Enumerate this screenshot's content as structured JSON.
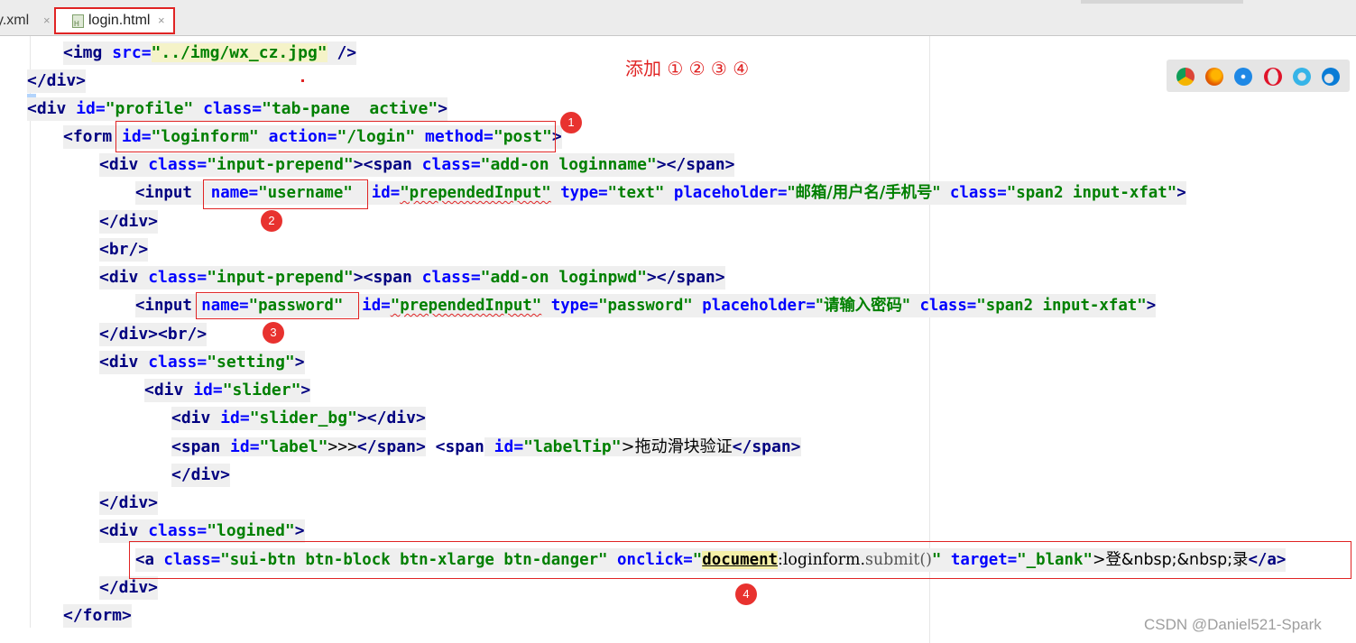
{
  "tabs": [
    {
      "label": "y.xml",
      "close": "×",
      "active": false
    },
    {
      "label": "login.html",
      "close": "×",
      "active": true
    }
  ],
  "annotation": {
    "title": "添加 ① ② ③ ④",
    "badges": [
      "1",
      "2",
      "3",
      "4"
    ]
  },
  "browsers": [
    "chrome-icon",
    "firefox-icon",
    "safari-icon",
    "opera-icon",
    "ie-icon",
    "edge-icon"
  ],
  "watermark": "CSDN @Daniel521-Spark",
  "code": {
    "l1": {
      "t1": "<img",
      "a1": " src=",
      "s1": "\"../img/wx_cz.jpg\"",
      "t2": " />"
    },
    "l2": {
      "t1": "</div>"
    },
    "l3": {
      "t1": "<div",
      "a1": " id=",
      "s1": "\"profile\"",
      "a2": " class=",
      "s2": "\"tab-pane  active\"",
      "t2": ">"
    },
    "l4": {
      "t1": "<form",
      "a1": " id=",
      "s1": "\"loginform\"",
      "a2": " action=",
      "s2": "\"/login\"",
      "a3": " method=",
      "s3": "\"post\"",
      "t2": ">"
    },
    "l5": {
      "t1": "<div",
      "a1": " class=",
      "s1": "\"input-prepend\"",
      "t2": "><span",
      "a2": " class=",
      "s2": "\"add-on loginname\"",
      "t3": "></span>"
    },
    "l6": {
      "t1": "<input",
      "a1": "  name=",
      "s1": "\"username\"",
      "a2": "  id=",
      "s2": "\"prependedInput\"",
      "a3": " type=",
      "s3": "\"text\"",
      "a4": " placeholder=",
      "s4": "\"邮箱/用户名/手机号\"",
      "a5": " class=",
      "s5": "\"span2 input-xfat\"",
      "t2": ">"
    },
    "l7": {
      "t1": "</div>"
    },
    "l8": {
      "t1": "<br/>"
    },
    "l9": {
      "t1": "<div",
      "a1": " class=",
      "s1": "\"input-prepend\"",
      "t2": "><span",
      "a2": " class=",
      "s2": "\"add-on loginpwd\"",
      "t3": "></span>"
    },
    "l10": {
      "t1": "<input",
      "a1": " name=",
      "s1": "\"password\"",
      "a2": "  id=",
      "s2": "\"prependedInput\"",
      "a3": " type=",
      "s3": "\"password\"",
      "a4": " placeholder=",
      "s4": "\"请输入密码\"",
      "a5": " class=",
      "s5": "\"span2 input-xfat\"",
      "t2": ">"
    },
    "l11": {
      "t1": "</div><br/>"
    },
    "l12": {
      "t1": "<div",
      "a1": " class=",
      "s1": "\"setting\"",
      "t2": ">"
    },
    "l13": {
      "t1": "<div",
      "a1": " id=",
      "s1": "\"slider\"",
      "t2": ">"
    },
    "l14": {
      "t1": "<div",
      "a1": " id=",
      "s1": "\"slider_bg\"",
      "t2": "></div>"
    },
    "l15": {
      "t1": "<span",
      "a1": " id=",
      "s1": "\"label\"",
      "p1": ">>>",
      "t2": "</span>",
      "t3": " <span",
      "a2": " id=",
      "s2": "\"labelTip\"",
      "p2": ">拖动滑块验证",
      "t4": "</span>"
    },
    "l16": {
      "t1": "</div>"
    },
    "l17": {
      "t1": "</div>"
    },
    "l18": {
      "t1": "<div",
      "a1": " class=",
      "s1": "\"logined\"",
      "t2": ">"
    },
    "l19": {
      "t1": "<a",
      "a1": " class=",
      "s1": "\"sui-btn btn-block btn-xlarge btn-danger\"",
      "a2": " onclick=",
      "s1b": "\"",
      "doc": "document",
      "p1": ":loginform.",
      "m1": "submit()",
      "s2": "\"",
      "a3": " target=",
      "s3": "\"_blank\"",
      "p2": ">登&nbsp;&nbsp;录",
      "t2": "</a>"
    },
    "l20": {
      "t1": "</div>"
    },
    "l21": {
      "t1": "</form>"
    }
  }
}
